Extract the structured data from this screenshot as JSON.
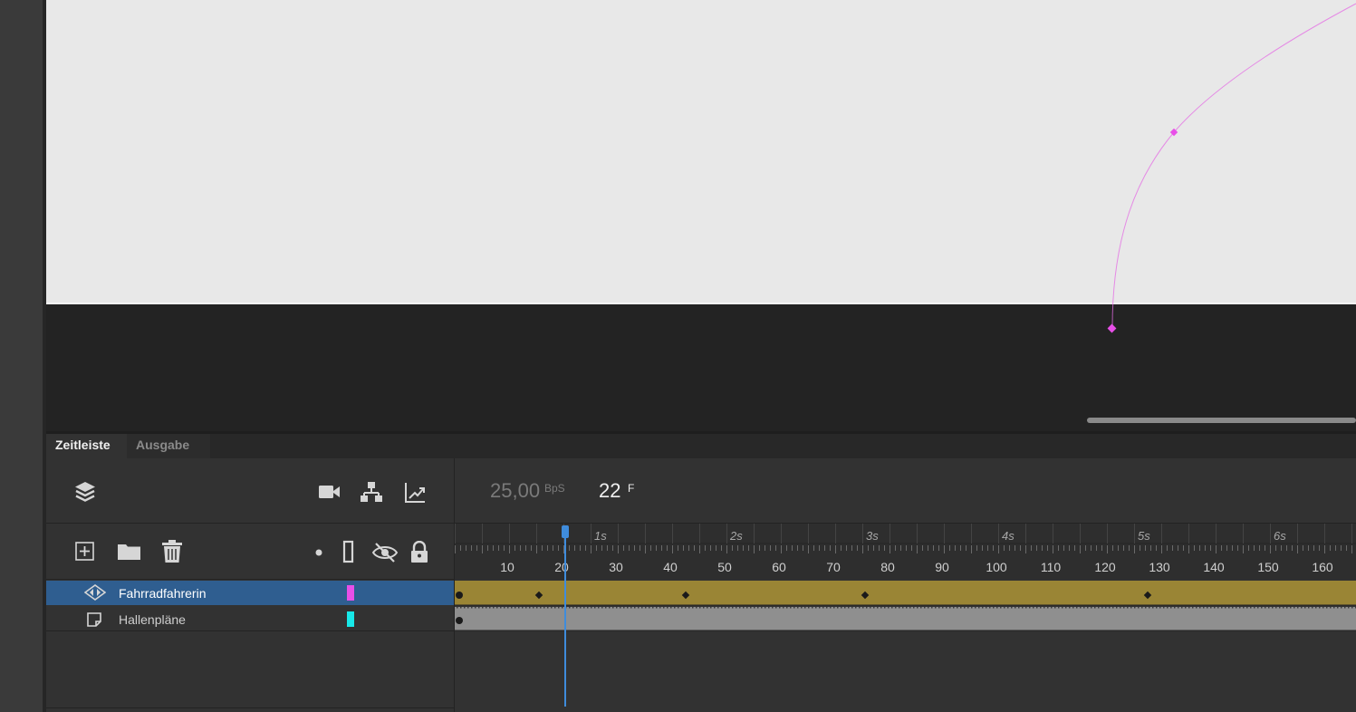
{
  "tabs": [
    {
      "label": "Zeitleiste",
      "active": true
    },
    {
      "label": "Ausgabe",
      "active": false
    }
  ],
  "timeline": {
    "fps_value": "25,00",
    "fps_unit": "BpS",
    "current_frame": "22",
    "frame_unit": "F",
    "second_markers": [
      "1s",
      "2s",
      "3s",
      "4s",
      "5s",
      "6s"
    ],
    "frame_ticks": [
      "10",
      "20",
      "30",
      "40",
      "50",
      "60",
      "70",
      "80",
      "90",
      "100",
      "110",
      "120",
      "130",
      "140",
      "150",
      "160"
    ],
    "playhead_frame": 22,
    "keyframes": {
      "Fahrradfahrerin": [
        1,
        16,
        43,
        76,
        128
      ],
      "Hallenpläne": [
        1
      ]
    }
  },
  "layers": [
    {
      "name": "Fahrradfahrerin",
      "type": "motion-tween-layer",
      "color": "#e84fe8",
      "selected": true
    },
    {
      "name": "Hallenpläne",
      "type": "normal-layer",
      "color": "#17e8e8",
      "selected": false
    }
  ],
  "colors": {
    "stage": "#e8e8e8",
    "motion_path": "#e46be4",
    "tween_span": "#9a8535",
    "static_span": "#8f8f8f",
    "playhead": "#3f8cdc",
    "selected_row": "#2f5e90"
  }
}
